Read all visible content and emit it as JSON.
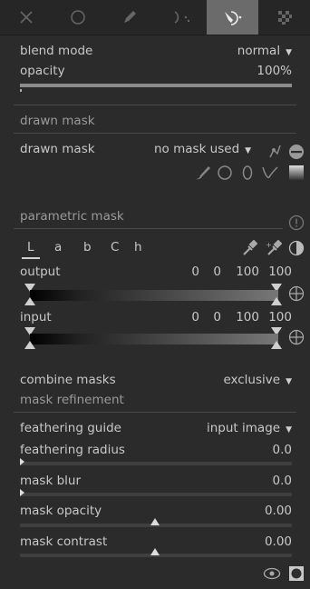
{
  "tabs": [
    {
      "icon": "close-x-icon"
    },
    {
      "icon": "circle-icon"
    },
    {
      "icon": "pencil-icon"
    },
    {
      "icon": "parametric-mask-icon"
    },
    {
      "icon": "drawn-parametric-mask-icon",
      "active": true
    },
    {
      "icon": "raster-mask-icon"
    }
  ],
  "blend": {
    "label": "blend mode",
    "value": "normal"
  },
  "opacity": {
    "label": "opacity",
    "value": "100%",
    "level": 1.0
  },
  "drawn_section": {
    "title": "drawn mask"
  },
  "drawn": {
    "label": "drawn mask",
    "value": "no mask used"
  },
  "parametric_section": {
    "title": "parametric mask"
  },
  "channels": [
    "L",
    "a",
    "b",
    "C",
    "h"
  ],
  "output": {
    "label": "output",
    "values": [
      "0",
      "0",
      "100",
      "100"
    ]
  },
  "input": {
    "label": "input",
    "values": [
      "0",
      "0",
      "100",
      "100"
    ]
  },
  "combine": {
    "label": "combine masks",
    "value": "exclusive"
  },
  "refinement_section": {
    "title": "mask refinement"
  },
  "feathering_guide": {
    "label": "feathering guide",
    "value": "input image"
  },
  "feathering_radius": {
    "label": "feathering radius",
    "value": "0.0",
    "level": 0.0
  },
  "mask_blur": {
    "label": "mask blur",
    "value": "0.0",
    "level": 0.0
  },
  "mask_opacity": {
    "label": "mask opacity",
    "value": "0.00",
    "level": 0.5
  },
  "mask_contrast": {
    "label": "mask contrast",
    "value": "0.00",
    "level": 0.5
  },
  "colors": {
    "background": "#2e2e2e",
    "text": "#c8c8c8",
    "active_tab": "#6b6b6b"
  }
}
